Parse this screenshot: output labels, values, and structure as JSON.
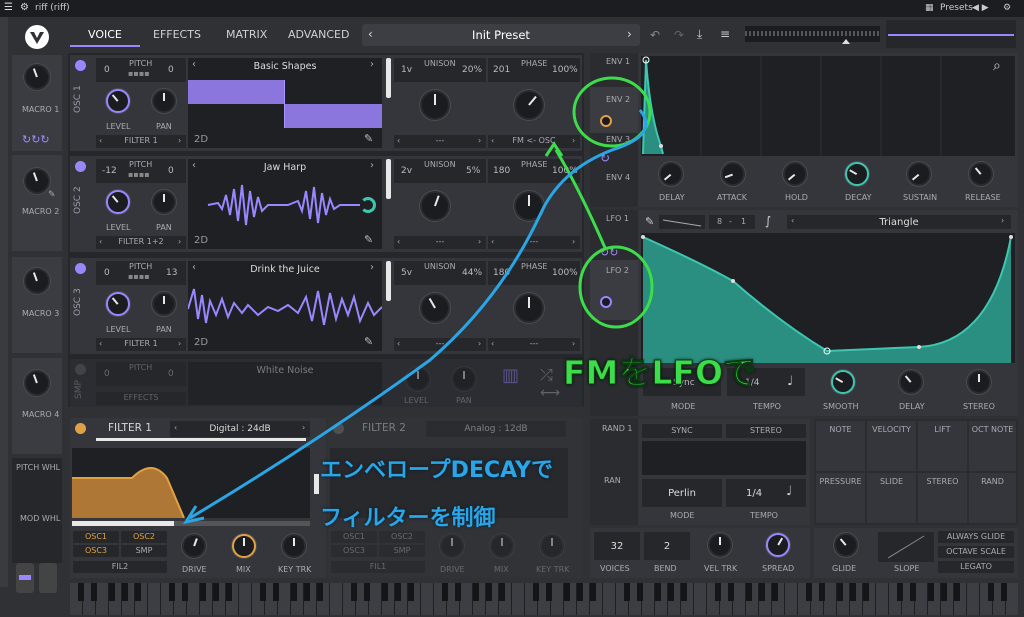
{
  "titlebar": {
    "app": "riff (riff)",
    "presets": "Presets"
  },
  "tabs": [
    "VOICE",
    "EFFECTS",
    "MATRIX",
    "ADVANCED"
  ],
  "preset": {
    "name": "Init Preset"
  },
  "macros": [
    "MACRO 1",
    "MACRO 2",
    "MACRO 3",
    "MACRO 4"
  ],
  "wheels": [
    "PITCH WHL",
    "MOD WHL"
  ],
  "osc": [
    {
      "label": "OSC 1",
      "pitch": "PITCH",
      "transpose": "0",
      "tune": "0",
      "wave": "Basic Shapes",
      "unison_voices": "1v",
      "unison": "UNISON",
      "unison_detune": "20%",
      "phase_val": "201",
      "phase": "PHASE",
      "phase_pct": "100%",
      "level": "LEVEL",
      "pan": "PAN",
      "dest": "FILTER 1",
      "mode": "---",
      "mode2": "FM <- OSC",
      "dim": "2D"
    },
    {
      "label": "OSC 2",
      "pitch": "PITCH",
      "transpose": "-12",
      "tune": "0",
      "wave": "Jaw Harp",
      "unison_voices": "2v",
      "unison": "UNISON",
      "unison_detune": "5%",
      "phase_val": "180",
      "phase": "PHASE",
      "phase_pct": "100%",
      "level": "LEVEL",
      "pan": "PAN",
      "dest": "FILTER 1+2",
      "mode": "---",
      "mode2": "---",
      "dim": "2D"
    },
    {
      "label": "OSC 3",
      "pitch": "PITCH",
      "transpose": "0",
      "tune": "13",
      "wave": "Drink the Juice",
      "unison_voices": "5v",
      "unison": "UNISON",
      "unison_detune": "44%",
      "phase_val": "180",
      "phase": "PHASE",
      "phase_pct": "100%",
      "level": "LEVEL",
      "pan": "PAN",
      "dest": "FILTER 1",
      "mode": "---",
      "mode2": "---",
      "dim": "2D"
    }
  ],
  "smp": {
    "label": "SMP",
    "pitch": "PITCH",
    "transpose": "0",
    "tune": "0",
    "wave": "White Noise",
    "level": "LEVEL",
    "pan": "PAN",
    "dest": "EFFECTS"
  },
  "filter1": {
    "title": "FILTER 1",
    "type": "Digital : 24dB",
    "srcs": [
      "OSC1",
      "OSC2",
      "OSC3",
      "SMP"
    ],
    "dest": "FIL2",
    "drive": "DRIVE",
    "mix": "MIX",
    "keytrk": "KEY TRK"
  },
  "filter2": {
    "title": "FILTER 2",
    "type": "Analog : 12dB",
    "srcs": [
      "OSC1",
      "OSC2",
      "OSC3",
      "SMP"
    ],
    "dest": "FIL1",
    "drive": "DRIVE",
    "mix": "MIX",
    "keytrk": "KEY TRK"
  },
  "envs": [
    "ENV 1",
    "ENV 2",
    "ENV 3",
    "ENV 4"
  ],
  "env_knobs": [
    "DELAY",
    "ATTACK",
    "HOLD",
    "DECAY",
    "SUSTAIN",
    "RELEASE"
  ],
  "lfos": [
    "LFO 1",
    "LFO 2"
  ],
  "lfo": {
    "grid_a": "8",
    "grid_sep": "-",
    "grid_b": "1",
    "shape": "Triangle",
    "mode_val": "Sync",
    "mode": "MODE",
    "tempo_val": "1/4",
    "tempo": "TEMPO",
    "smooth": "SMOOTH",
    "delay": "DELAY",
    "stereo": "STEREO"
  },
  "rand": {
    "title": "RAND 1",
    "sync": "SYNC",
    "stereo": "STEREO",
    "style": "Perlin",
    "mode": "MODE",
    "tempo_val": "1/4",
    "tempo": "TEMPO",
    "other": "RAN"
  },
  "sources_row1": [
    "NOTE",
    "VELOCITY",
    "LIFT",
    "OCT NOTE"
  ],
  "sources_row2": [
    "PRESSURE",
    "SLIDE",
    "STEREO",
    "RAND"
  ],
  "voice": {
    "voices_val": "32",
    "voices": "VOICES",
    "bend_val": "2",
    "bend": "BEND",
    "veltrk": "VEL TRK",
    "spread": "SPREAD"
  },
  "glide": {
    "glide": "GLIDE",
    "slope": "SLOPE",
    "always": "ALWAYS GLIDE",
    "octave": "OCTAVE SCALE",
    "legato": "LEGATO"
  },
  "annotations": {
    "fm": "FMをLFOで",
    "env1": "エンベロープDECAYで",
    "env2": "フィルターを制御"
  },
  "colors": {
    "accent": "#9a86ff",
    "teal": "#3ec6b0",
    "orange": "#e0a044",
    "annot_green": "#3ddc4a",
    "annot_blue": "#2aa6e6"
  }
}
